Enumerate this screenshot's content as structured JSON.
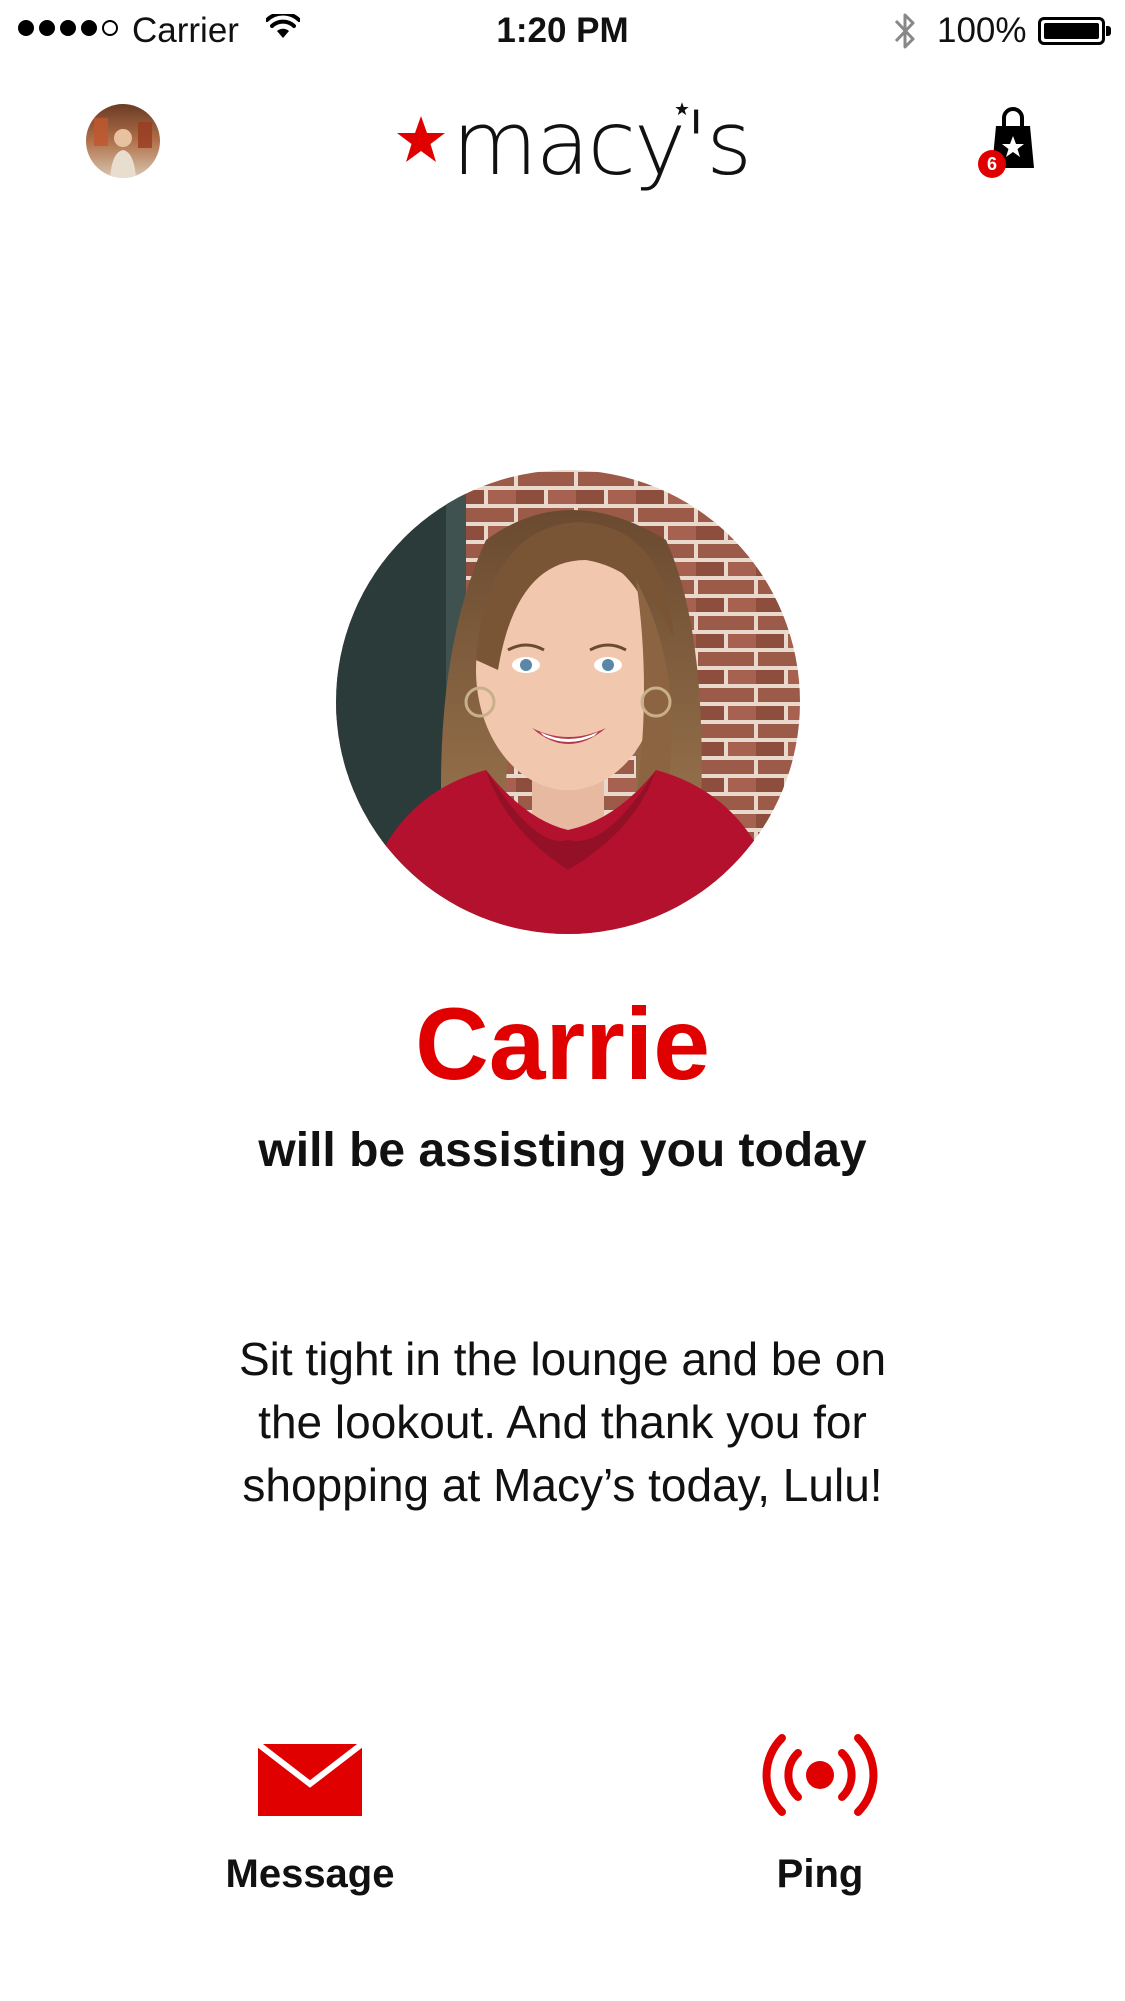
{
  "status_bar": {
    "carrier": "Carrier",
    "time": "1:20 PM",
    "battery_percent": "100%",
    "signal_bars_filled": 4,
    "signal_bars_total": 5,
    "battery_level": 1.0
  },
  "header": {
    "logo_text": "macy's",
    "cart_count": "6",
    "icons": {
      "avatar": "user-avatar-icon",
      "cart": "shopping-bag-icon"
    }
  },
  "associate": {
    "name": "Carrie",
    "tagline": "will be assisting you today",
    "message_lines": [
      "Sit tight in the lounge and be on",
      "the lookout. And thank you for",
      "shopping at Macy’s today, Lulu!"
    ]
  },
  "actions": {
    "message_label": "Message",
    "ping_label": "Ping"
  },
  "colors": {
    "brand_red": "#e00000",
    "text": "#111111",
    "background": "#ffffff"
  }
}
